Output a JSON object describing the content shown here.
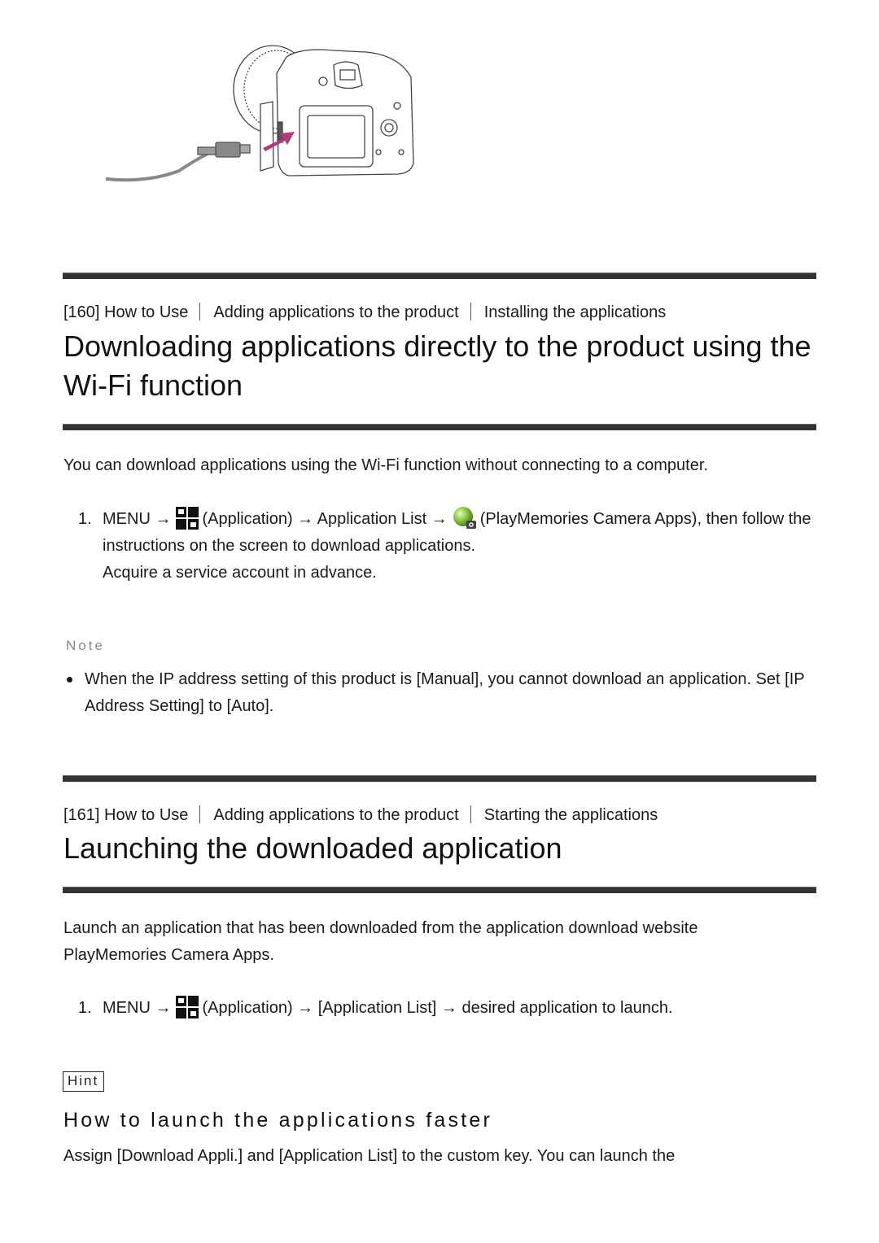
{
  "illustration": {
    "description": "Camera with USB cable being connected to its multi terminal",
    "icon": "camera-usb-connection-illustration",
    "arrow_color": "#b5397a"
  },
  "section160": {
    "breadcrumb": {
      "index": "[160]",
      "items": [
        "How to Use",
        "Adding applications to the product",
        "Installing the applications"
      ]
    },
    "title": "Downloading applications directly to the product using the Wi-Fi function",
    "intro": "You can download applications using the Wi-Fi function without connecting to a computer.",
    "steps": [
      {
        "num": "1.",
        "parts": {
          "menu": "MENU →",
          "app_label": "(Application) → Application List →",
          "pm_label": "(PlayMemories Camera Apps), then follow the instructions on the screen to download applications."
        },
        "extra": "Acquire a service account in advance."
      }
    ],
    "note": {
      "label": "Note",
      "items": [
        "When the IP address setting of this product is [Manual], you cannot download an application. Set [IP Address Setting] to [Auto]."
      ]
    }
  },
  "section161": {
    "breadcrumb": {
      "index": "[161]",
      "items": [
        "How to Use",
        "Adding applications to the product",
        "Starting the applications"
      ]
    },
    "title": "Launching the downloaded application",
    "intro": "Launch an application that has been downloaded from the application download website PlayMemories Camera Apps.",
    "steps": [
      {
        "num": "1.",
        "parts": {
          "menu": "MENU →",
          "app_label": "(Application) → [Application List] → desired application to launch."
        }
      }
    ],
    "hint": {
      "label": "Hint",
      "title": "How to launch the applications faster",
      "text": "Assign [Download Appli.] and [Application List] to the custom key. You can launch the"
    }
  }
}
